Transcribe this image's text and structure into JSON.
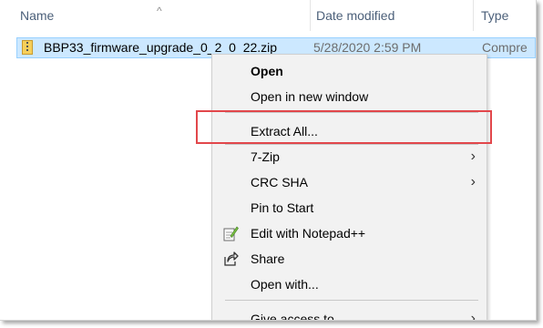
{
  "header": {
    "name_col": "Name",
    "date_col": "Date modified",
    "type_col": "Type",
    "sort_indicator": "chevron-up-icon"
  },
  "file": {
    "name": "BBP33_firmware_upgrade_0_2_0_22.zip",
    "date": "5/28/2020 2:59 PM",
    "type": "Compre",
    "icon": "zip-folder-icon"
  },
  "menu": {
    "items": [
      {
        "label": "Open"
      },
      {
        "label": "Open in new window"
      },
      {
        "label": "Extract All..."
      },
      {
        "label": "7-Zip"
      },
      {
        "label": "CRC SHA"
      },
      {
        "label": "Pin to Start"
      },
      {
        "label": "Edit with Notepad++",
        "icon": "notepad-plus-plus-icon"
      },
      {
        "label": "Share",
        "icon": "share-icon"
      },
      {
        "label": "Open with..."
      },
      {
        "label": "Give access to"
      }
    ]
  },
  "colors": {
    "selection_bg": "#cce8ff",
    "selection_border": "#99d1ff",
    "menu_bg": "#f2f2f2",
    "highlight_box": "#e2474b",
    "header_text": "#4c607a"
  }
}
